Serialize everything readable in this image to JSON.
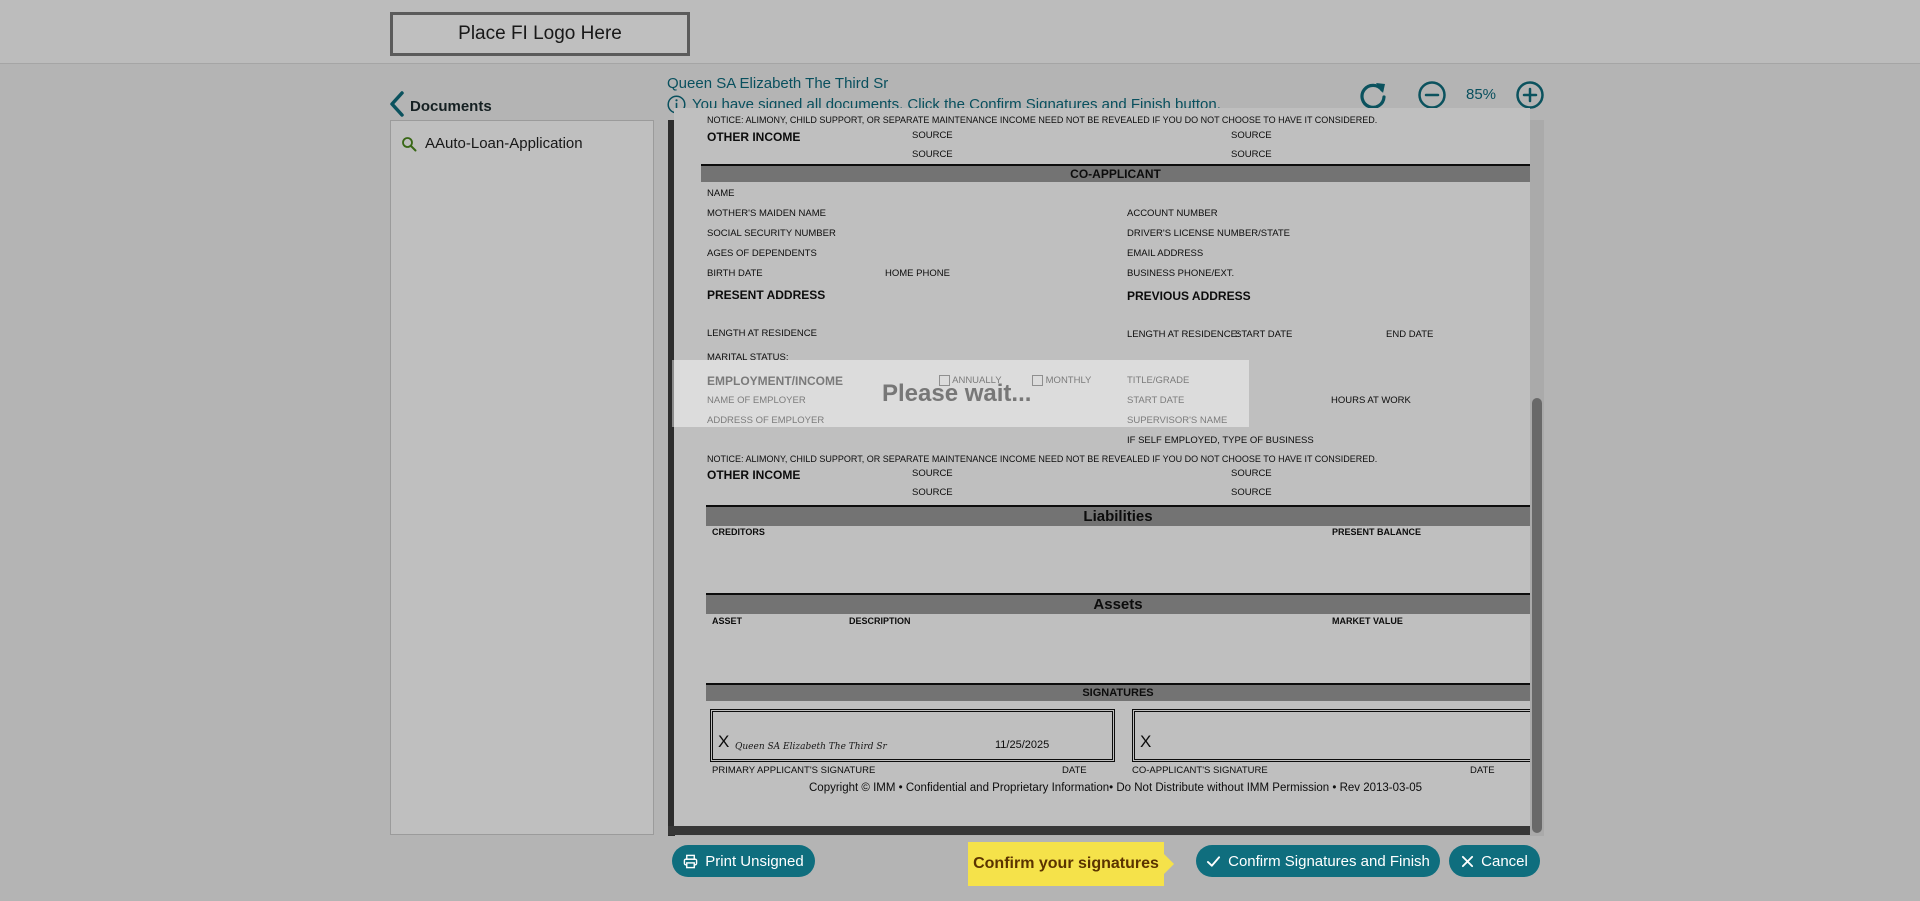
{
  "header": {
    "logo_text": "Place FI Logo Here"
  },
  "sidebar": {
    "title": "Documents",
    "items": [
      {
        "label": "AAuto-Loan-Application"
      }
    ]
  },
  "viewer_header": {
    "user_name": "Queen SA Elizabeth The Third Sr",
    "info_message": "You have signed all documents. Click the Confirm Signatures and Finish button.",
    "zoom": "85%"
  },
  "document": {
    "notice": "NOTICE: ALIMONY, CHILD SUPPORT, OR SEPARATE MAINTENANCE INCOME NEED NOT BE REVEALED IF YOU DO NOT CHOOSE TO HAVE IT CONSIDERED.",
    "other_income": "OTHER INCOME",
    "source": "SOURCE",
    "co_applicant": "CO-APPLICANT",
    "name": "NAME",
    "mothers_maiden_name": "MOTHER'S MAIDEN NAME",
    "account_number": "ACCOUNT NUMBER",
    "ssn": "SOCIAL SECURITY NUMBER",
    "drivers_license": "DRIVER'S LICENSE NUMBER/STATE",
    "ages_of_dependents": "AGES OF DEPENDENTS",
    "email_address": "EMAIL ADDRESS",
    "birth_date": "BIRTH DATE",
    "home_phone": "HOME PHONE",
    "business_phone": "BUSINESS PHONE/EXT.",
    "present_address": "PRESENT ADDRESS",
    "previous_address": "PREVIOUS ADDRESS",
    "length_at_residence": "LENGTH AT RESIDENCE",
    "length_at_residence_prev": "LENGTH AT RESIDENCE:",
    "start_date_label": "START DATE",
    "end_date_label": "END DATE",
    "marital_status": "MARITAL STATUS:",
    "employment_income": "EMPLOYMENT/INCOME",
    "annually": "ANNUALLY",
    "monthly": "MONTHLY",
    "title_grade": "TITLE/GRADE",
    "name_of_employer": "NAME OF EMPLOYER",
    "start_date": "START DATE",
    "hours_at_work": "HOURS AT WORK",
    "address_of_employer": "ADDRESS OF EMPLOYER",
    "supervisors_name": "SUPERVISOR'S NAME",
    "self_employed": "IF SELF EMPLOYED, TYPE OF BUSINESS",
    "liabilities": "Liabilities",
    "creditors": "CREDITORS",
    "present_balance": "PRESENT BALANCE",
    "assets": "Assets",
    "asset": "ASSET",
    "description": "DESCRIPTION",
    "market_value": "MARKET VALUE",
    "signatures": "SIGNATURES",
    "sig_x": "X",
    "primary_signature_text": "Queen SA Elizabeth The Third Sr",
    "primary_sig_date": "11/25/2025",
    "primary_signature_label": "PRIMARY APPLICANT'S SIGNATURE",
    "date_label": "DATE",
    "co_signature_label": "CO-APPLICANT'S SIGNATURE",
    "copyright": "Copyright © IMM • Confidential and Proprietary Information• Do Not Distribute without IMM Permission • Rev 2013-03-05"
  },
  "loading": {
    "text": "Please wait..."
  },
  "footer": {
    "print_label": "Print Unsigned",
    "callout": "Confirm your signatures",
    "confirm_label": "Confirm Signatures and Finish",
    "cancel_label": "Cancel"
  },
  "colors": {
    "accent": "#0f6e7e",
    "callout": "#f5e24a",
    "section_bar": "#9a9a9a"
  }
}
